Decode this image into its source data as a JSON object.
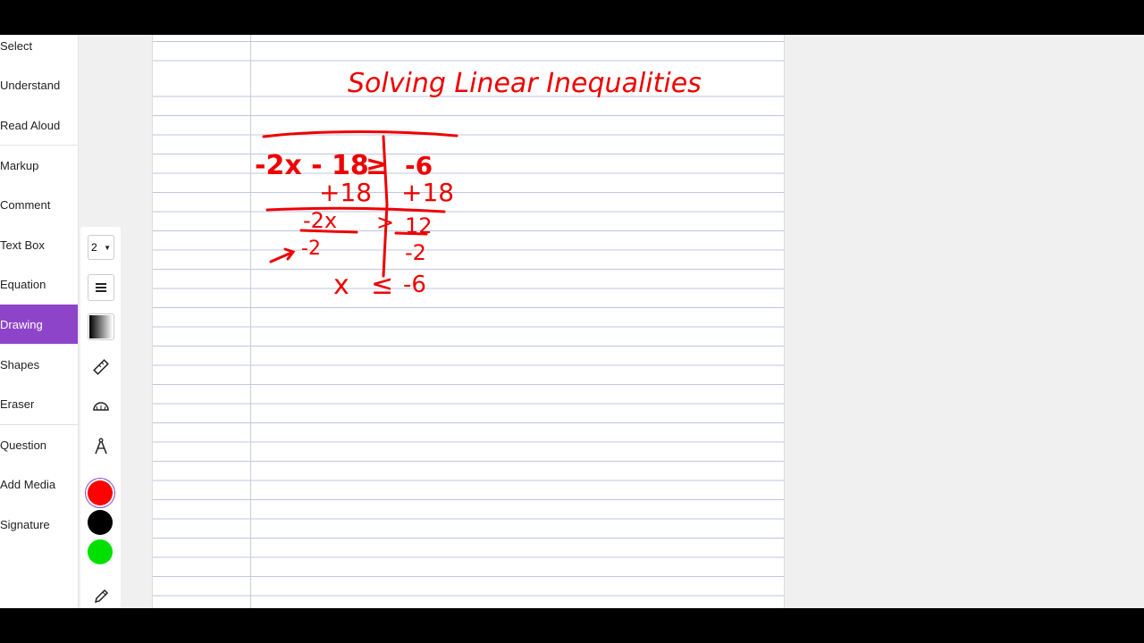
{
  "sidebar": {
    "items": [
      {
        "label": "Select"
      },
      {
        "label": "Understand"
      },
      {
        "label": "Read Aloud"
      },
      {
        "label": "Markup"
      },
      {
        "label": "Comment"
      },
      {
        "label": "Text Box"
      },
      {
        "label": "Equation"
      },
      {
        "label": "Drawing"
      },
      {
        "label": "Shapes"
      },
      {
        "label": "Eraser"
      },
      {
        "label": "Question"
      },
      {
        "label": "Add Media"
      },
      {
        "label": "Signature"
      }
    ],
    "active": "Drawing",
    "accent": "#8e44c8"
  },
  "drawing_toolbar": {
    "stroke_size": "2",
    "colors": [
      "#ff0000",
      "#000000",
      "#00e000"
    ],
    "selected_color": "#ff0000",
    "icons": [
      "menu-icon",
      "gradient-icon",
      "ruler-icon",
      "protractor-icon",
      "compass-icon",
      "pencil-icon"
    ]
  },
  "worksheet": {
    "title": "Solving Linear Inequalities",
    "ink_color": "#e00000",
    "steps": {
      "line1_left": "-2x - 18",
      "line1_op": "≥",
      "line1_right": "-6",
      "line2_left": "+18",
      "line2_right": "+18",
      "line3_left": "-2x",
      "line3_op": ">",
      "line3_right": "12",
      "line4_left": "-2",
      "line4_right": "-2",
      "line5_left": "x",
      "line5_op": "≤",
      "line5_right": "-6"
    }
  }
}
